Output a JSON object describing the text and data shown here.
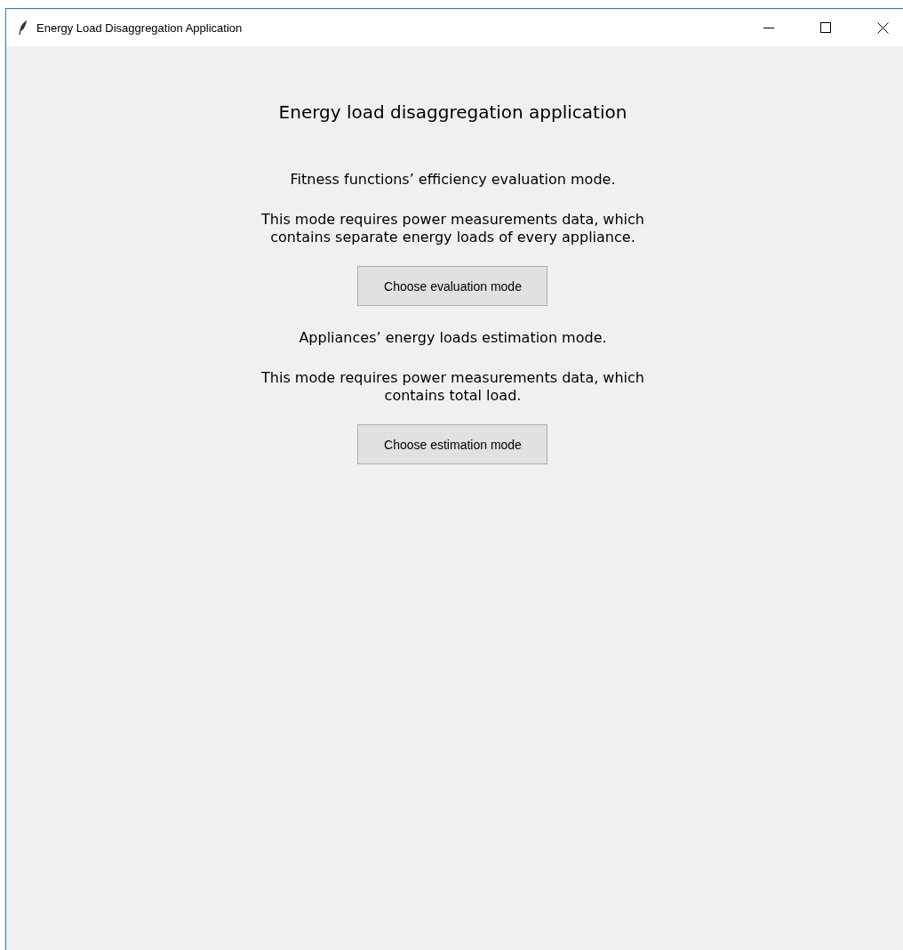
{
  "window": {
    "title": "Energy Load Disaggregation Application"
  },
  "heading": "Energy load disaggregation application",
  "modes": [
    {
      "heading": "Fitness functions’ efficiency evaluation mode.",
      "description": "This mode requires power measurements data, which\ncontains separate energy loads of every appliance.",
      "button": "Choose evaluation mode"
    },
    {
      "heading": "Appliances’ energy loads estimation mode.",
      "description": "This mode requires power measurements data, which\ncontains total load.",
      "button": "Choose estimation mode"
    }
  ]
}
